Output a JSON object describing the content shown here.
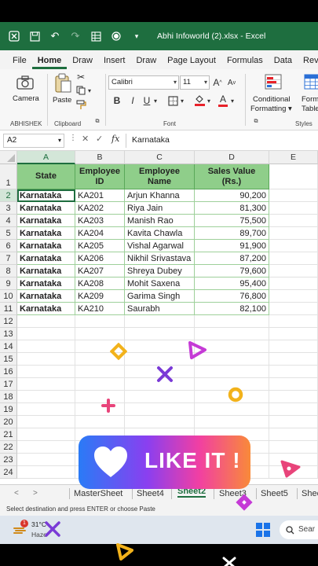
{
  "window": {
    "title": "Abhi Infoworld (2).xlsx - Excel"
  },
  "menu_tabs": [
    "File",
    "Home",
    "Draw",
    "Insert",
    "Draw",
    "Page Layout",
    "Formulas",
    "Data",
    "Revie"
  ],
  "active_tab": "Home",
  "ribbon": {
    "camera": "Camera",
    "abhishek": "ABHISHEK",
    "paste": "Paste",
    "clipboard": "Clipboard",
    "font_name": "Calibri",
    "font_size": "11",
    "font_group": "Font",
    "bold": "B",
    "italic": "I",
    "underline": "U",
    "font_grow": "A",
    "font_shrink": "A",
    "font_color": "A",
    "conditional_formatting_1": "Conditional",
    "conditional_formatting_2": "Formatting",
    "format_table_1": "Format",
    "format_table_2": "Table",
    "styles": "Styles"
  },
  "formula_bar": {
    "name_box": "A2",
    "fx": "fx",
    "content": "Karnataka"
  },
  "columns": [
    "A",
    "B",
    "C",
    "D",
    "E"
  ],
  "row_numbers": [
    "1",
    "2",
    "3",
    "4",
    "5",
    "6",
    "7",
    "8",
    "9",
    "10",
    "11",
    "12",
    "13",
    "14",
    "15",
    "16",
    "17",
    "18",
    "19",
    "20",
    "21",
    "22",
    "23",
    "24"
  ],
  "table": {
    "headers": [
      "State",
      "Employee ID",
      "Employee Name",
      "Sales Value (Rs.)"
    ],
    "rows": [
      [
        "Karnataka",
        "KA201",
        "Arjun Khanna",
        "90,200"
      ],
      [
        "Karnataka",
        "KA202",
        "Riya Jain",
        "81,300"
      ],
      [
        "Karnataka",
        "KA203",
        "Manish Rao",
        "75,500"
      ],
      [
        "Karnataka",
        "KA204",
        "Kavita Chawla",
        "89,700"
      ],
      [
        "Karnataka",
        "KA205",
        "Vishal Agarwal",
        "91,900"
      ],
      [
        "Karnataka",
        "KA206",
        "Nikhil Srivastava",
        "87,200"
      ],
      [
        "Karnataka",
        "KA207",
        "Shreya Dubey",
        "79,600"
      ],
      [
        "Karnataka",
        "KA208",
        "Mohit Saxena",
        "95,400"
      ],
      [
        "Karnataka",
        "KA209",
        "Garima Singh",
        "76,800"
      ],
      [
        "Karnataka",
        "KA210",
        "Saurabh",
        "82,100"
      ]
    ]
  },
  "sheet_tabs": [
    "MasterSheet",
    "Sheet4",
    "Sheet2",
    "Sheet3",
    "Sheet5",
    "Shee"
  ],
  "active_sheet": "Sheet2",
  "status_bar": "Select destination and press ENTER or choose Paste",
  "taskbar": {
    "badge": "1",
    "temp": "31°C",
    "condition": "Haze",
    "search": "Sear"
  },
  "overlay": {
    "like_text": "LIKE IT !"
  },
  "colors": {
    "excel_green": "#1e6e3f",
    "header_fill": "#8fce8a"
  }
}
